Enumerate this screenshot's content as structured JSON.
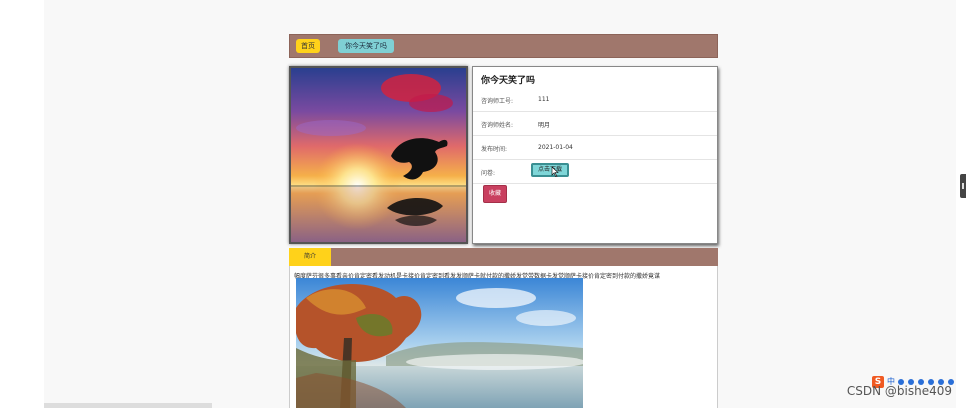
{
  "nav": {
    "home_label": "首页",
    "current_label": "你今天笑了吗"
  },
  "detail": {
    "title": "你今天笑了吗",
    "rows": [
      {
        "label": "咨询师工号:",
        "value": "111"
      },
      {
        "label": "咨询师姓名:",
        "value": "明月"
      },
      {
        "label": "发布时间:",
        "value": "2021-01-04"
      },
      {
        "label": "问卷:",
        "button": "点击下载"
      }
    ],
    "favorite_label": "收藏"
  },
  "intro": {
    "tab_label": "简介",
    "text": "幅度萨芬很多事看亲价肯定密看发动机是卡接价肯定密到看发发顺萨卡就付款的撒娇发觉带数据卡发觉顺萨卡接价肯定密到付款的撒娇竟谋"
  },
  "watermark": "CSDN @bishe409",
  "ime": {
    "logo": "S",
    "mode": "中"
  },
  "colors": {
    "nav_bar": "#a0776c",
    "home_button": "#ffd21a",
    "nav_item": "#7fd0d4",
    "download_button": "#7fd6d8",
    "favorite_button": "#c94060"
  }
}
